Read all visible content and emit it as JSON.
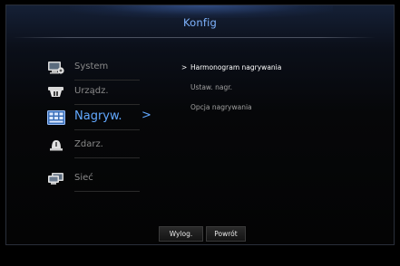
{
  "header": {
    "title": "Konfig"
  },
  "sidebar": {
    "items": [
      {
        "label": "System",
        "icon": "monitor-gear-icon",
        "active": false
      },
      {
        "label": "Urządz.",
        "icon": "camera-dome-icon",
        "active": false
      },
      {
        "label": "Nagryw.",
        "icon": "recording-grid-icon",
        "active": true,
        "arrow": ">"
      },
      {
        "label": "Zdarz.",
        "icon": "event-alarm-icon",
        "active": false
      },
      {
        "label": "Sieć",
        "icon": "network-monitor-icon",
        "active": false
      }
    ]
  },
  "submenu": {
    "marker": ">",
    "items": [
      {
        "label": "Harmonogram nagrywania",
        "selected": true
      },
      {
        "label": "Ustaw. nagr.",
        "selected": false
      },
      {
        "label": "Opcja nagrywania",
        "selected": false
      }
    ]
  },
  "footer": {
    "logout_label": "Wylog.",
    "back_label": "Powrót"
  },
  "colors": {
    "accent": "#62a8ff",
    "title": "#7fb4ff",
    "inactive_text": "#8a8a8a",
    "background": "#000000"
  }
}
